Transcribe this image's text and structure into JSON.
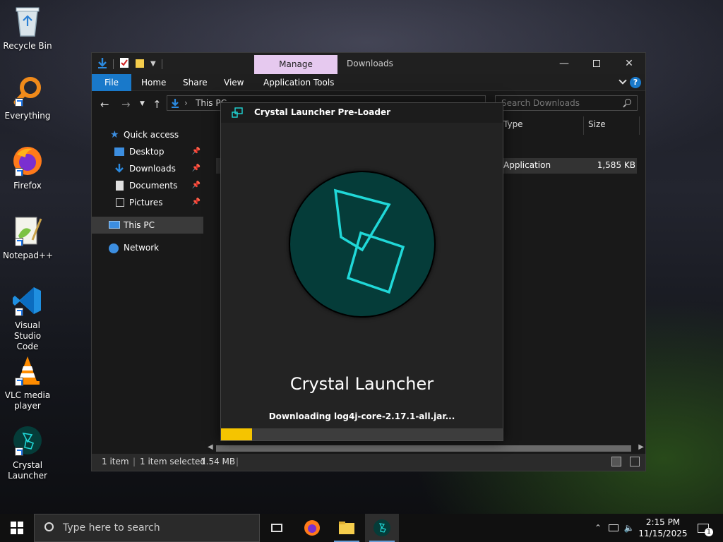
{
  "desktop": {
    "icons": [
      {
        "label": "Recycle Bin"
      },
      {
        "label": "Everything"
      },
      {
        "label": "Firefox"
      },
      {
        "label": "Notepad++"
      },
      {
        "label": "Visual Studio Code"
      },
      {
        "label": "VLC media player"
      },
      {
        "label": "Crystal Launcher"
      }
    ]
  },
  "explorer": {
    "title": "Downloads",
    "context_tab": "Manage",
    "ribbon_tabs": [
      "File",
      "Home",
      "Share",
      "View",
      "Application Tools"
    ],
    "address": "This PC",
    "search_placeholder": "Search Downloads",
    "nav": {
      "quick_access": "Quick access",
      "pinned": [
        "Desktop",
        "Downloads",
        "Documents",
        "Pictures"
      ],
      "this_pc": "This PC",
      "network": "Network"
    },
    "columns": {
      "type": "Type",
      "size": "Size"
    },
    "file_row": {
      "type": "Application",
      "size": "1,585 KB"
    },
    "status": {
      "count": "1 item",
      "selected": "1 item selected",
      "size": "1.54 MB"
    }
  },
  "loader": {
    "title": "Crystal Launcher Pre-Loader",
    "app_name": "Crystal Launcher",
    "status": "Downloading log4j-core-2.17.1-all.jar...",
    "progress": 0.11,
    "accent": "#f5c400",
    "logo_color": "#20d8d8"
  },
  "taskbar": {
    "search_placeholder": "Type here to search",
    "time": "2:15 PM",
    "date": "11/15/2025",
    "notification_count": "1"
  }
}
